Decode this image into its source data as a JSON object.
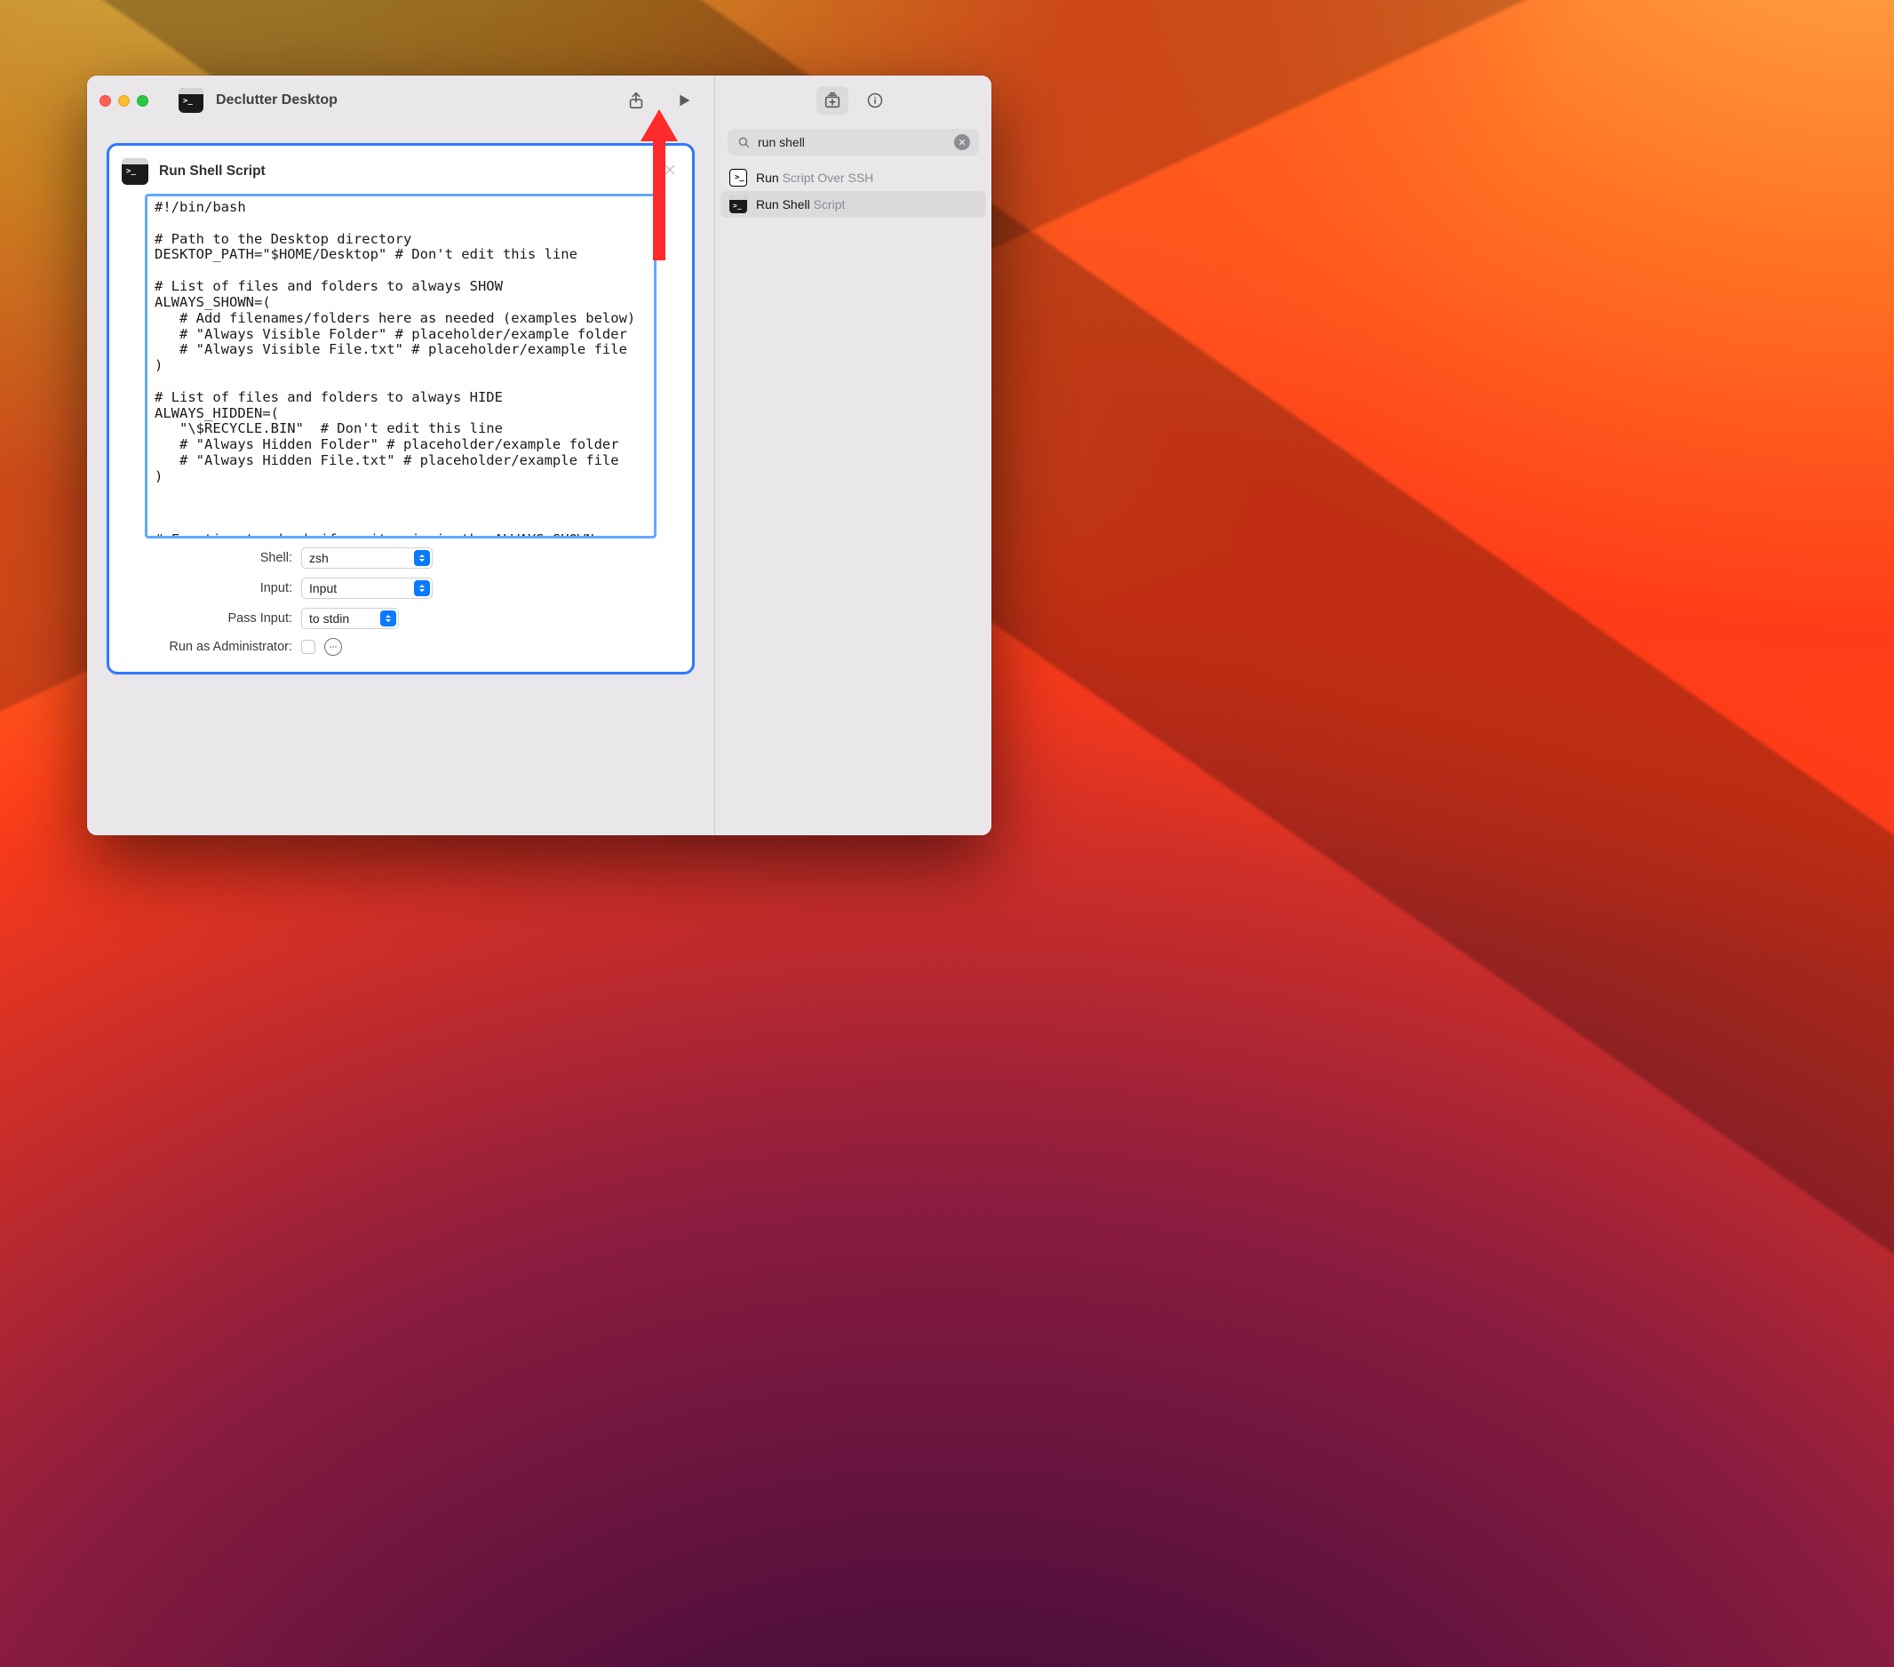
{
  "window": {
    "title": "Declutter Desktop"
  },
  "card": {
    "title": "Run Shell Script",
    "code": "#!/bin/bash\n\n# Path to the Desktop directory\nDESKTOP_PATH=\"$HOME/Desktop\" # Don't edit this line\n\n# List of files and folders to always SHOW\nALWAYS_SHOWN=(\n   # Add filenames/folders here as needed (examples below)\n   # \"Always Visible Folder\" # placeholder/example folder\n   # \"Always Visible File.txt\" # placeholder/example file\n)\n\n# List of files and folders to always HIDE\nALWAYS_HIDDEN=(\n   \"\\$RECYCLE.BIN\"  # Don't edit this line\n   # \"Always Hidden Folder\" # placeholder/example folder\n   # \"Always Hidden File.txt\" # placeholder/example file\n)\n\n\n\n# Function to check if an item is in the ALWAYS_SHOWN array",
    "fields": {
      "shell_label": "Shell:",
      "shell_value": "zsh",
      "input_label": "Input:",
      "input_value": "Input",
      "pass_label": "Pass Input:",
      "pass_value": "to stdin",
      "admin_label": "Run as Administrator:"
    }
  },
  "library": {
    "search_value": "run shell",
    "search_placeholder": "Search",
    "results": [
      {
        "prefix": "Run ",
        "match": "Script Over SSH"
      },
      {
        "prefix": "Run Shell ",
        "match": "Script"
      }
    ]
  }
}
